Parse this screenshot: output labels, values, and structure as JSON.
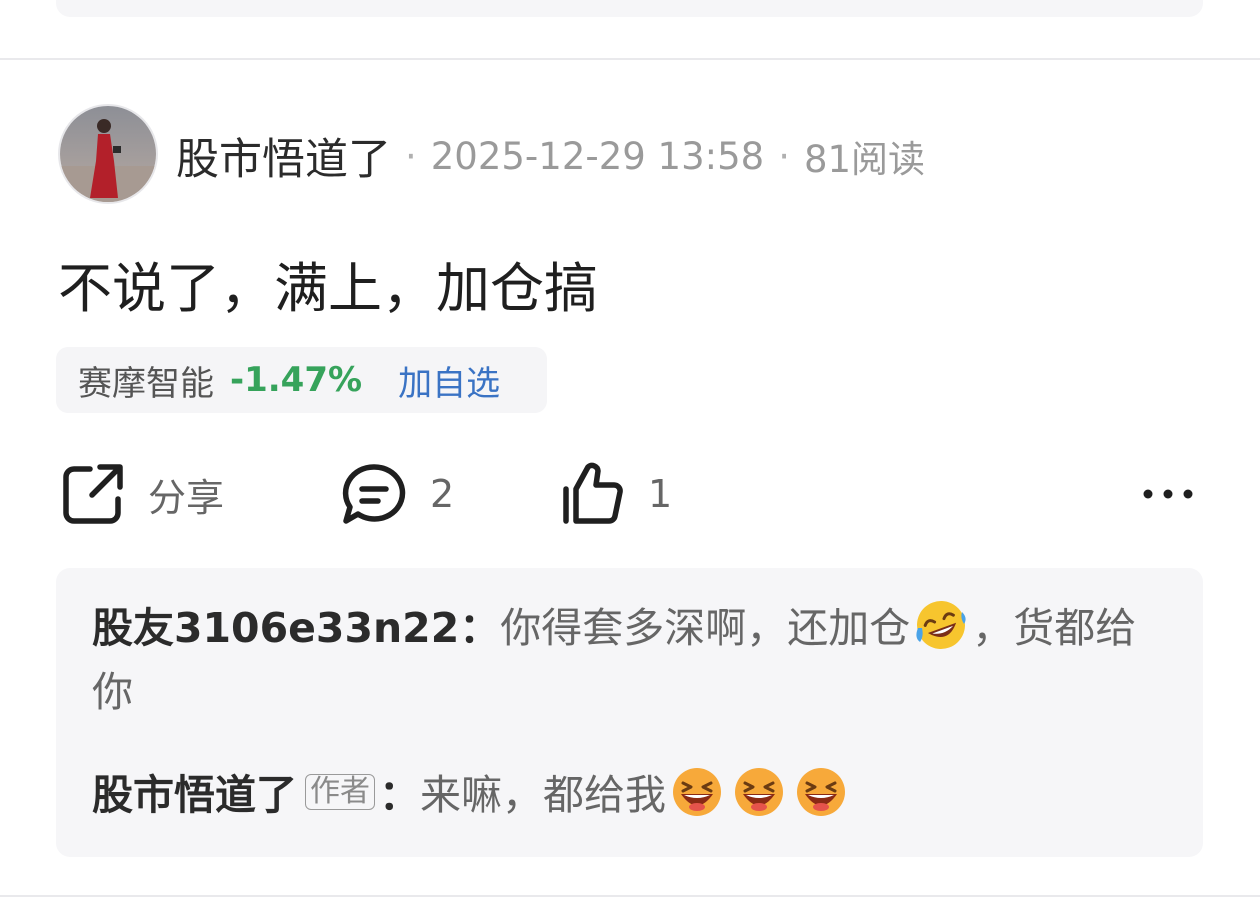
{
  "post": {
    "author": "股市悟道了",
    "time": "2025-12-29 13:58",
    "reads": "81阅读",
    "text": "不说了，满上，加仓搞",
    "separator": "·"
  },
  "stock": {
    "name": "赛摩智能",
    "change": "-1.47%",
    "add_label": "加自选",
    "change_color": "#36a35b"
  },
  "actions": {
    "share_label": "分享",
    "comment_count": "2",
    "like_count": "1",
    "more_icon": "more-dots-icon"
  },
  "comments": [
    {
      "user": "股友3106e33n22",
      "colon": "：",
      "text_before": "你得套多深啊，还加仓",
      "emoji": "rolling-on-floor-laughing",
      "text_after": "，货都给你"
    },
    {
      "user": "股市悟道了",
      "tag": "作者",
      "colon": "：",
      "text": "来嘛，都给我",
      "emoji": "grinning-squinting-face",
      "emoji_count": 3
    }
  ]
}
